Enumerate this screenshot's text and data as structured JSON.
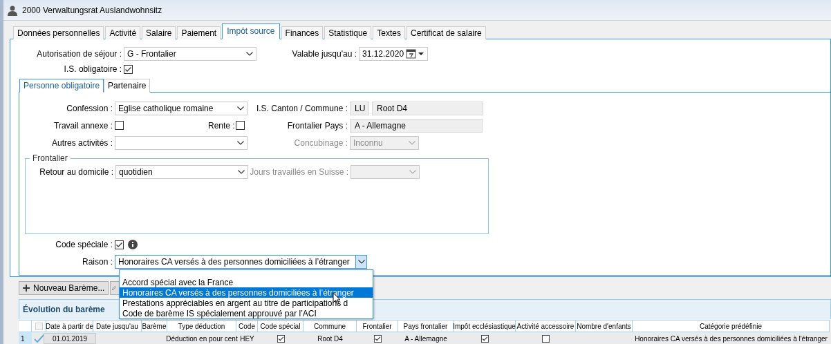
{
  "window": {
    "title": "2000 Verwaltungsrat Auslandwohnsitz"
  },
  "tabs": [
    {
      "label": "Données personnelles",
      "selected": false
    },
    {
      "label": "Activité",
      "selected": false
    },
    {
      "label": "Salaire",
      "selected": false
    },
    {
      "label": "Paiement",
      "selected": false
    },
    {
      "label": "Impôt source",
      "selected": true
    },
    {
      "label": "Finances",
      "selected": false
    },
    {
      "label": "Statistique",
      "selected": false
    },
    {
      "label": "Textes",
      "selected": false
    },
    {
      "label": "Certificat de salaire",
      "selected": false
    }
  ],
  "residence": {
    "label": "Autorisation de séjour :",
    "value": "G - Frontalier"
  },
  "valid_until": {
    "label": "Valable jusqu'au :",
    "value": "31.12.2020"
  },
  "is_obligatory": {
    "label": "I.S. obligatoire :",
    "checked": true
  },
  "sub_tabs": [
    {
      "label": "Personne obligatoire",
      "selected": true
    },
    {
      "label": "Partenaire",
      "selected": false
    }
  ],
  "confession": {
    "label": "Confession :",
    "value": "Eglise catholique romaine"
  },
  "canton": {
    "label": "I.S. Canton / Commune :",
    "canton": "LU",
    "commune": "Root D4"
  },
  "side_work": {
    "label": "Travail annexe :",
    "checked": false
  },
  "pension": {
    "label": "Rente :",
    "checked": false
  },
  "border_country": {
    "label": "Frontalier Pays :",
    "value": "A - Allemagne"
  },
  "other_activities": {
    "label": "Autres activités :"
  },
  "cohabitation": {
    "label": "Concubinage :",
    "value": "Inconnu",
    "disabled": true
  },
  "frontalier": {
    "legend": "Frontalier",
    "return_home": {
      "label": "Retour au domicile :",
      "value": "quotidien"
    },
    "days_worked": {
      "label": "Jours travaillés en Suisse :",
      "disabled": true
    }
  },
  "special_code": {
    "label": "Code spéciale :",
    "checked": true
  },
  "reason": {
    "label": "Raison :",
    "value": "Honoraires CA versés à des personnes domiciliées à l’étranger",
    "open": true,
    "options": [
      {
        "label": "Accord spécial avec la France",
        "selected": false
      },
      {
        "label": "Honoraires CA versés à des personnes domiciliées à l’étranger",
        "selected": true
      },
      {
        "label": "Prestations appréciables en argent au titre de participations d",
        "selected": false
      },
      {
        "label": "Code de barème IS spécialement approuvé par l’ACI",
        "selected": false
      }
    ]
  },
  "new_button": {
    "label": "Nouveau Barème..."
  },
  "history": {
    "title": "Évolution du barème",
    "select_all": {
      "checked": false
    },
    "columns": [
      "Date à partir de",
      "Date jusqu'au",
      "Barème",
      "Type déduction",
      "Code",
      "Code spécial",
      "Commune",
      "Frontalier",
      "Pays frontalier",
      "Impôt ecclésiastique",
      "Activité accessoire",
      "Nombre d'enfants",
      "Catégorie prédéfinie"
    ],
    "rows": [
      {
        "number": "1",
        "current": true,
        "cells": [
          {
            "kind": "date",
            "text": "01.01.2019"
          },
          {
            "kind": "empty"
          },
          {
            "kind": "empty"
          },
          {
            "kind": "text",
            "text": "Déduction en pour cent"
          },
          {
            "kind": "text",
            "text": "HEY"
          },
          {
            "kind": "check",
            "checked": true
          },
          {
            "kind": "text",
            "text": "Root D4"
          },
          {
            "kind": "check",
            "checked": true
          },
          {
            "kind": "text",
            "text": "A - Allemagne"
          },
          {
            "kind": "check",
            "checked": true
          },
          {
            "kind": "check",
            "checked": false
          },
          {
            "kind": "empty"
          },
          {
            "kind": "text",
            "text": "Honoraires CA versés à des personnes domiciliées à l'étranger"
          }
        ]
      }
    ]
  }
}
